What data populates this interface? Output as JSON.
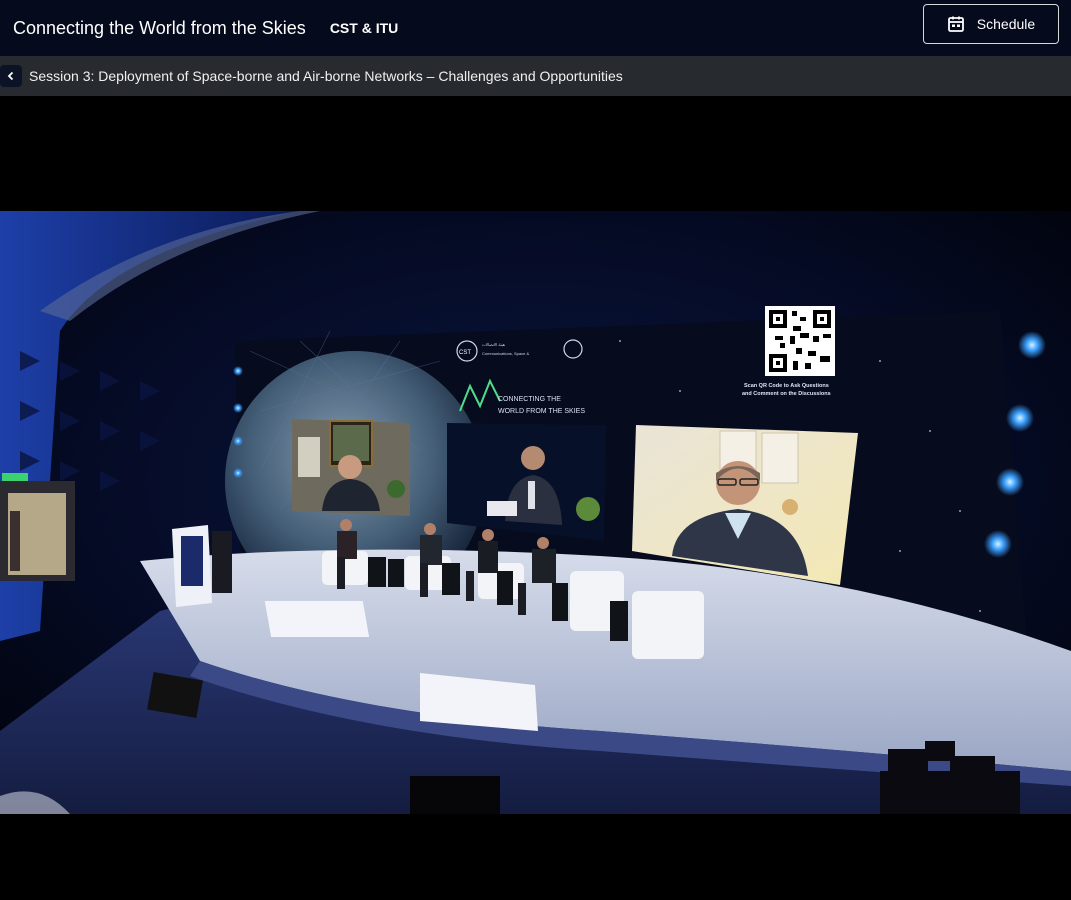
{
  "header": {
    "title": "Connecting the World from the Skies",
    "org": "CST & ITU",
    "schedule_label": "Schedule"
  },
  "session": {
    "title": "Session 3: Deployment of Space-borne and Air-borne Networks – Challenges and Opportunities"
  },
  "video": {
    "screen_brand": "CONNECTING THE WORLD FROM THE SKIES",
    "org_caption": "Communications, Space & Technology Commission",
    "qr_caption_line1": "Scan QR Code to Ask Questions",
    "qr_caption_line2": "and Comment on the Discussions"
  },
  "colors": {
    "header_bg": "#050a1c",
    "session_bar_bg": "#272a2e",
    "stage_light": "#3aa0ff"
  }
}
